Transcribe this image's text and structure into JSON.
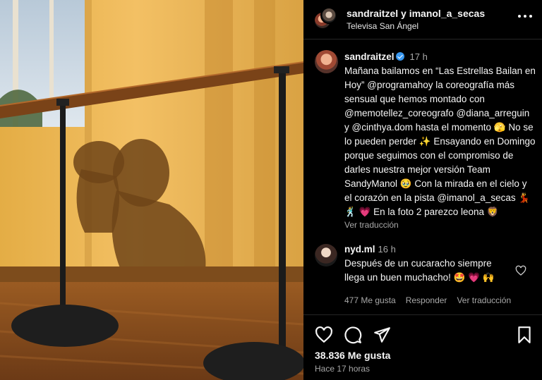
{
  "header": {
    "title": "sandraitzel y imanol_a_secas",
    "location": "Televisa San Ángel"
  },
  "caption": {
    "username": "sandraitzel",
    "time": "17 h",
    "text": "Mañana bailamos en “Las Estrellas Bailan en Hoy” @programahoy la coreografía más sensual que hemos montado con @memotellez_coreografo @diana_arreguin y @cinthya.dom hasta el momento 🫣 No se lo pueden perder ✨ Ensayando en Domingo porque seguimos con el compromiso de darles nuestra mejor versión Team SandyManol 🥹 Con la mirada en el cielo y el corazón en la pista @imanol_a_secas 💃🕺 💗 En la foto 2 parezco leona 🦁",
    "translate_label": "Ver traducción"
  },
  "comment": {
    "username": "nyd.ml",
    "time": "16 h",
    "text": "Después de un cucaracho siempre llega un buen muchacho! 🤩 💗 🙌",
    "likes": "477 Me gusta",
    "reply": "Responder",
    "translate": "Ver traducción"
  },
  "footer": {
    "likes": "38.836 Me gusta",
    "ago": "Hace 17 horas"
  },
  "icons": {
    "like": "heart-icon",
    "comment": "comment-icon",
    "share": "share-icon",
    "save": "bookmark-icon",
    "more": "more-icon",
    "verified": "verified-badge-icon"
  },
  "colors": {
    "background": "#000000",
    "muted": "#a8a8a8",
    "verified": "#3897f0"
  }
}
